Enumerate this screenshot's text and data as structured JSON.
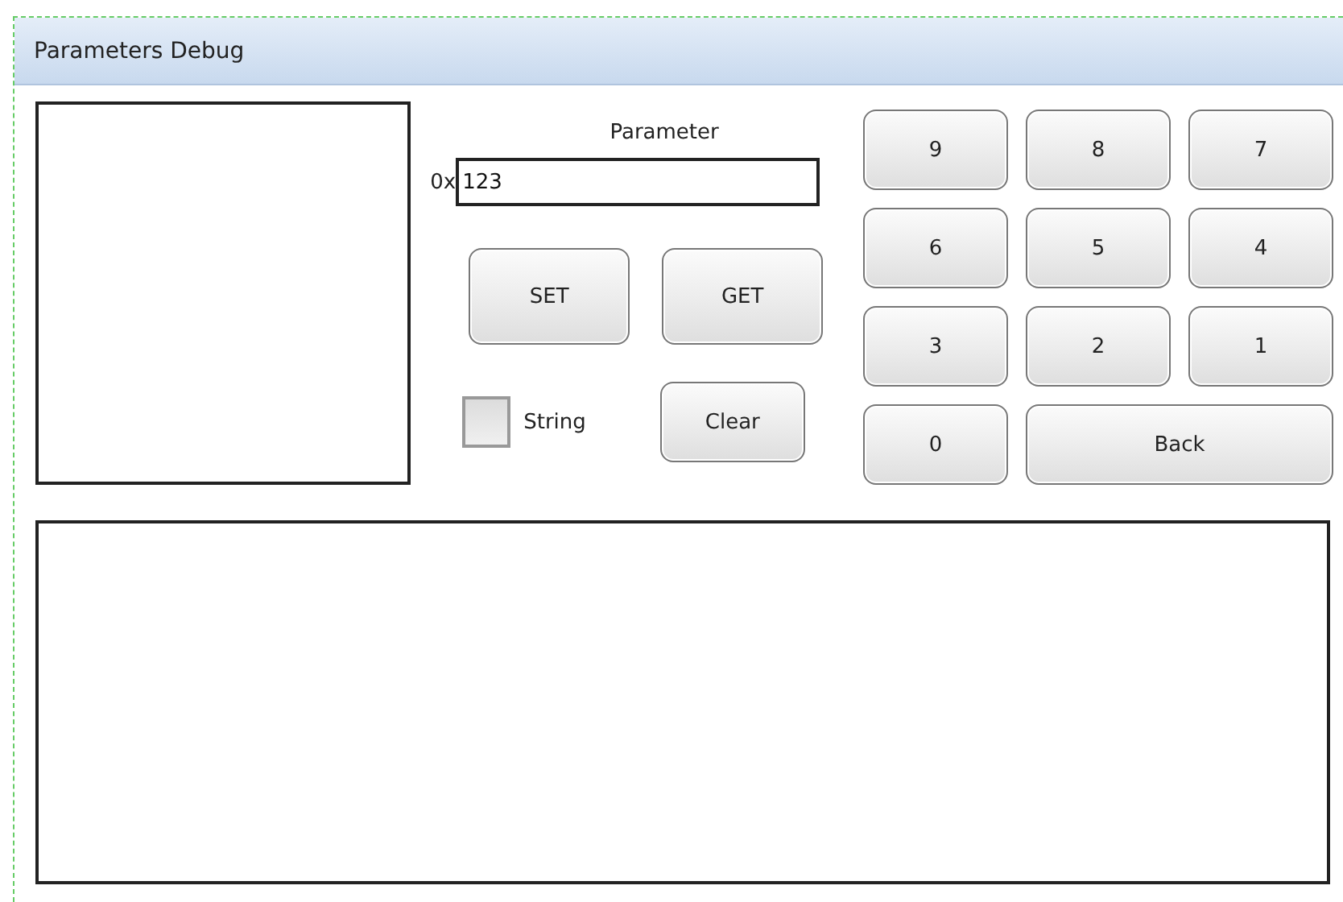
{
  "window": {
    "title": "Parameters Debug"
  },
  "parameter": {
    "label": "Parameter",
    "prefix": "0x",
    "value": "123"
  },
  "actions": [
    {
      "label": "SET"
    },
    {
      "label": "GET"
    }
  ],
  "string_option": {
    "label": "String",
    "checked": false
  },
  "clear_button": {
    "label": "Clear"
  },
  "keypad": [
    {
      "label": "9",
      "kind": "key"
    },
    {
      "label": "8",
      "kind": "key"
    },
    {
      "label": "7",
      "kind": "key"
    },
    {
      "label": "6",
      "kind": "key"
    },
    {
      "label": "5",
      "kind": "key"
    },
    {
      "label": "4",
      "kind": "key"
    },
    {
      "label": "3",
      "kind": "key"
    },
    {
      "label": "2",
      "kind": "key"
    },
    {
      "label": "1",
      "kind": "key"
    },
    {
      "label": "0",
      "kind": "key"
    },
    {
      "label": "Back",
      "kind": "wide"
    }
  ]
}
